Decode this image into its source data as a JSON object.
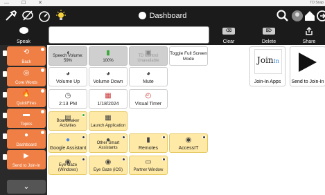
{
  "window": {
    "controls": "—  ☐  ✕",
    "app_hint": "TD Snap"
  },
  "header": {
    "title": "Dashboard"
  },
  "toolbar": {
    "speak": "Speak",
    "clear": "Clear",
    "delete": "Delete",
    "share": "Share",
    "clear_key": "⌫",
    "delete_key": "⌦"
  },
  "message": {
    "text": ""
  },
  "sidebar": {
    "items": [
      {
        "label": "Back",
        "glyph": "⟲"
      },
      {
        "label": "Core Words",
        "glyph": "◎"
      },
      {
        "label": "QuickFires",
        "glyph": "🔥"
      },
      {
        "label": "Topics",
        "glyph": "▬"
      },
      {
        "label": "Dashboard",
        "glyph": "●"
      },
      {
        "label": "Send to Join-In",
        "glyph": "▶"
      }
    ],
    "more": "⌄"
  },
  "tiles": {
    "speech_volume": "Speech Volume: 59%",
    "battery": "100%",
    "td_control": "TD Control Unavailable",
    "toggle_full": "Toggle Full Screen Mode",
    "volume_up": "Volume Up",
    "volume_down": "Volume Down",
    "mute": "Mute",
    "time": "2:13 PM",
    "date": "1/18/2024",
    "visual_timer": "Visual Timer",
    "boardmaker": "Boardmaker Activities",
    "launch_app": "Launch Application",
    "google_assistant": "Google Assistant",
    "other_assistants": "Other Smart Assistants",
    "remotes": "Remotes",
    "accessit": "AccessIT",
    "eye_gaze_windows": "Eye Gaze (Windows)",
    "eye_gaze_ios": "Eye Gaze (iOS)",
    "partner_window": "Partner Window",
    "join_in_apps": "Join-In Apps",
    "send_to_join_in": "Send to Join-In",
    "join_logo": "Join",
    "join_logo_b": "In"
  },
  "colors": {
    "topbar": "#1b1b1b",
    "sidebar_button": "#ef7f45",
    "tile_yellow": "#ffe9a6",
    "tile_grey": "#cfcfcf"
  }
}
